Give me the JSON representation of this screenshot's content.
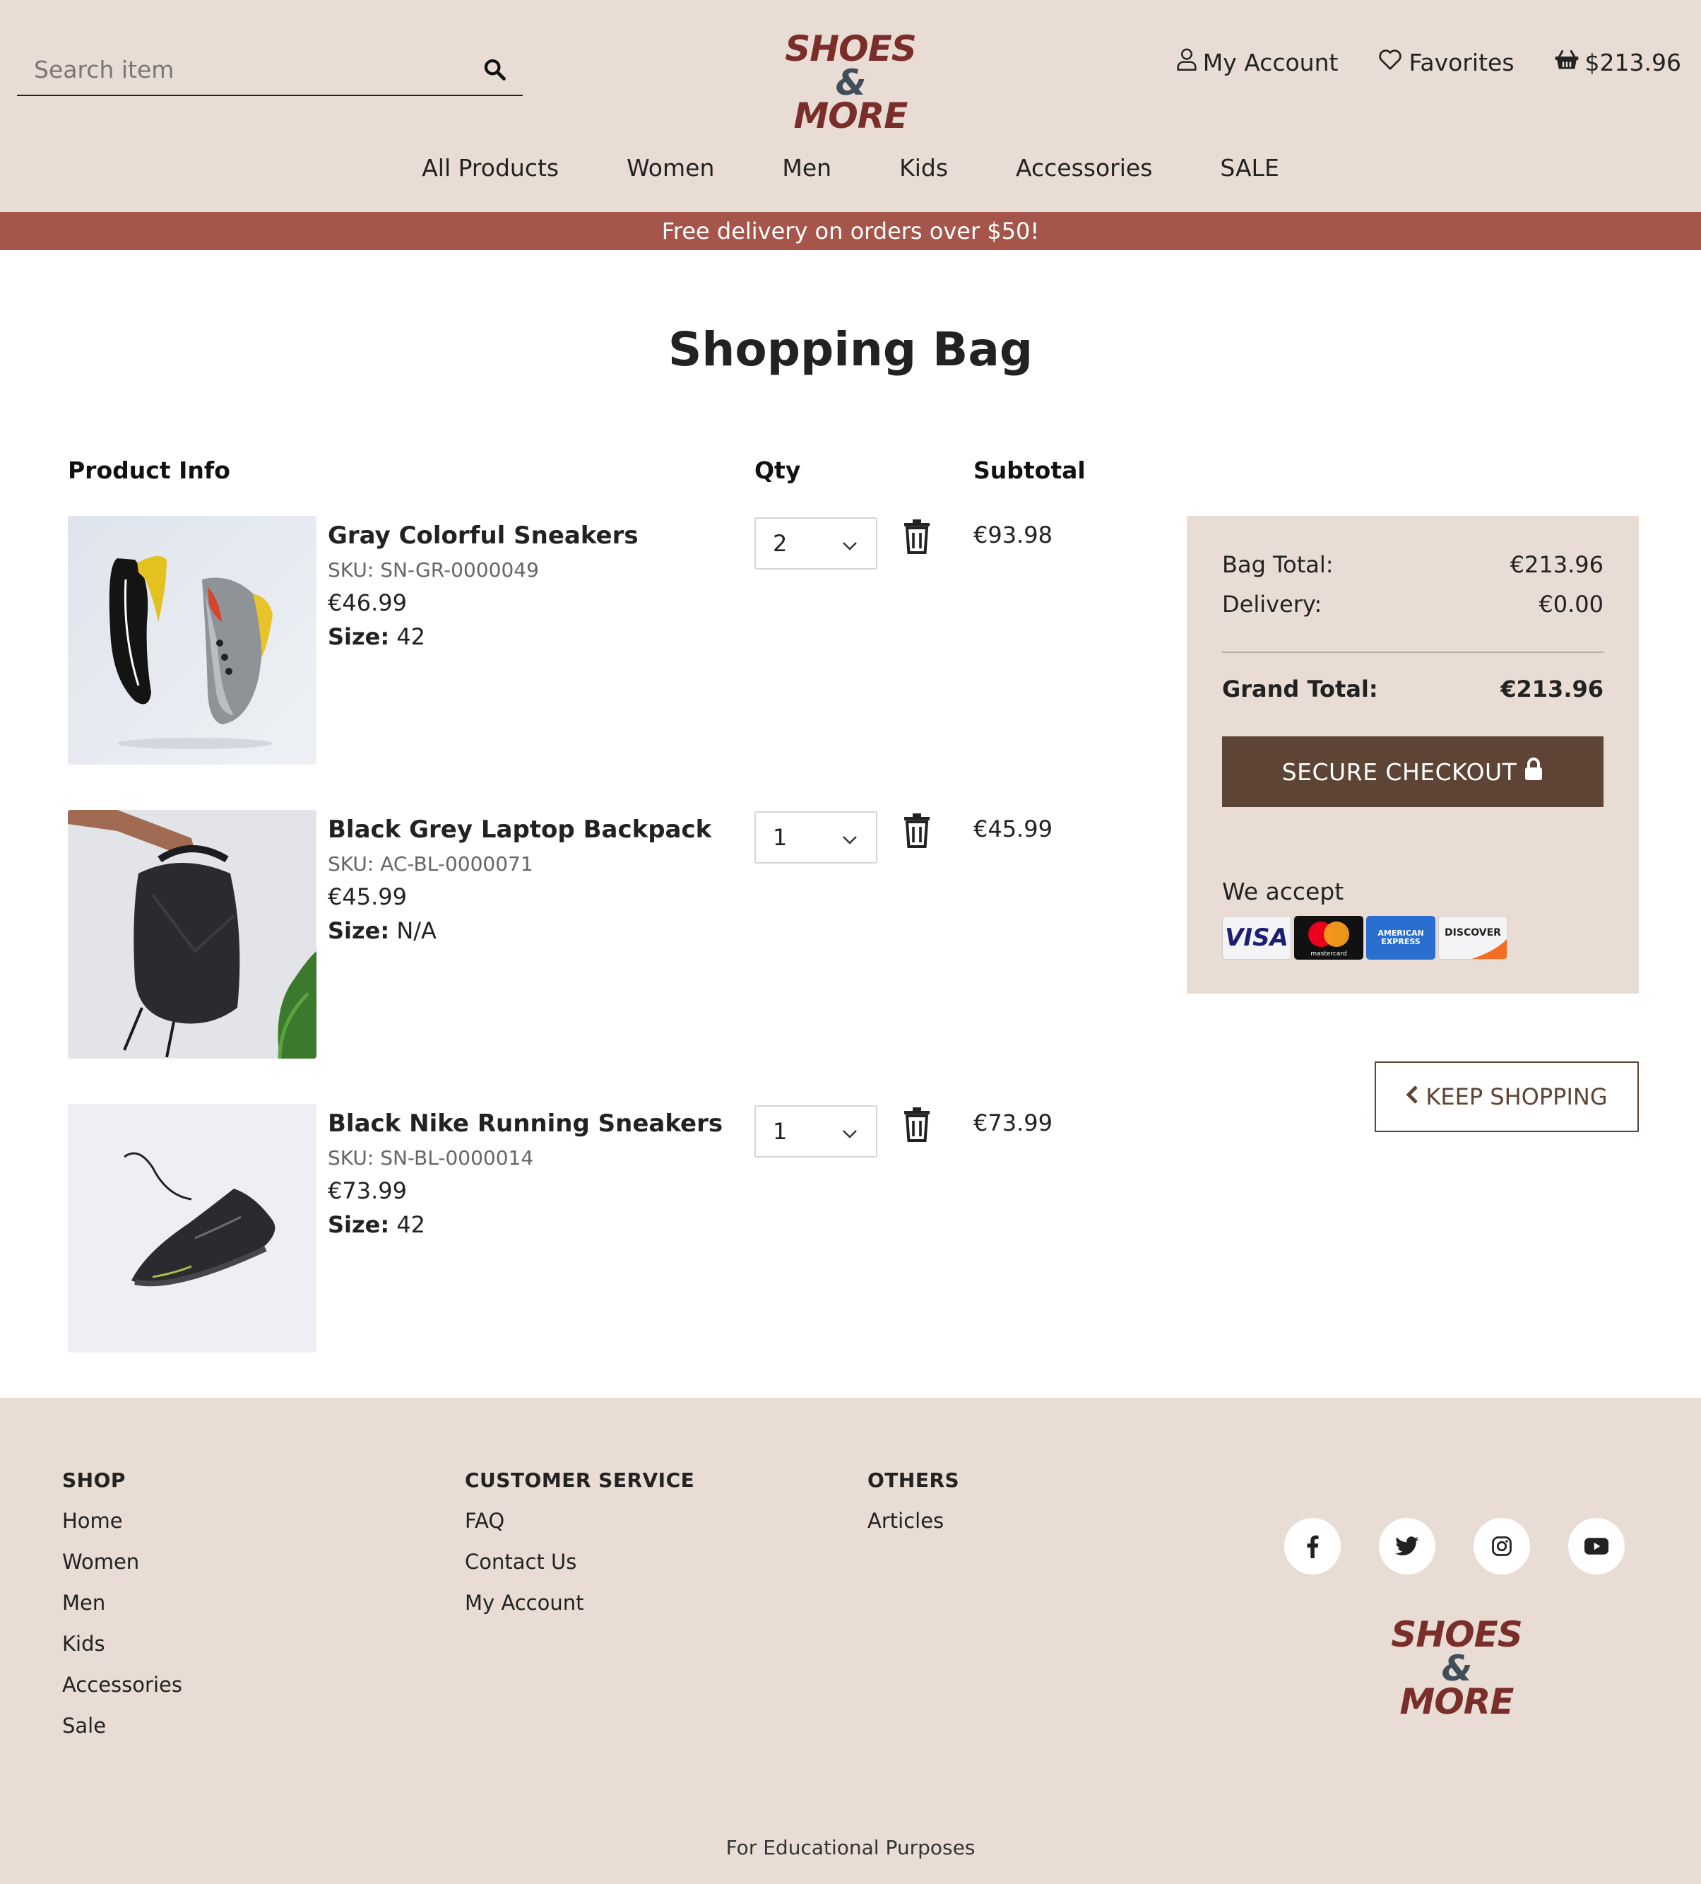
{
  "header": {
    "search_placeholder": "Search item",
    "logo_line1": "SHOES",
    "logo_amp": "&",
    "logo_line2": "MORE",
    "account_label": "My Account",
    "favorites_label": "Favorites",
    "cart_total": "$213.96"
  },
  "nav": [
    "All Products",
    "Women",
    "Men",
    "Kids",
    "Accessories",
    "SALE"
  ],
  "banner": "Free delivery on orders over $50!",
  "page_title": "Shopping Bag",
  "columns": {
    "product": "Product Info",
    "qty": "Qty",
    "subtotal": "Subtotal"
  },
  "items": [
    {
      "name": "Gray Colorful Sneakers",
      "sku": "SKU: SN-GR-0000049",
      "price": "€46.99",
      "size_label": "Size:",
      "size": "42",
      "qty": "2",
      "subtotal": "€93.98",
      "image": "gray-sneakers-image"
    },
    {
      "name": "Black Grey Laptop Backpack",
      "sku": "SKU: AC-BL-0000071",
      "price": "€45.99",
      "size_label": "Size:",
      "size": "N/A",
      "qty": "1",
      "subtotal": "€45.99",
      "image": "backpack-image"
    },
    {
      "name": "Black Nike Running Sneakers",
      "sku": "SKU: SN-BL-0000014",
      "price": "€73.99",
      "size_label": "Size:",
      "size": "42",
      "qty": "1",
      "subtotal": "€73.99",
      "image": "black-sneaker-image"
    }
  ],
  "summary": {
    "bag_total_label": "Bag Total:",
    "bag_total": "€213.96",
    "delivery_label": "Delivery:",
    "delivery": "€0.00",
    "grand_total_label": "Grand Total:",
    "grand_total": "€213.96",
    "checkout_label": "SECURE CHECKOUT",
    "we_accept": "We accept",
    "cards": [
      "VISA",
      "mastercard",
      "AMERICAN EXPRESS",
      "DISCOVER"
    ]
  },
  "keep_shopping": "KEEP SHOPPING",
  "footer": {
    "shop_heading": "SHOP",
    "shop_links": [
      "Home",
      "Women",
      "Men",
      "Kids",
      "Accessories",
      "Sale"
    ],
    "service_heading": "CUSTOMER SERVICE",
    "service_links": [
      "FAQ",
      "Contact Us",
      "My Account"
    ],
    "others_heading": "OTHERS",
    "others_links": [
      "Articles"
    ],
    "socials": [
      "facebook-icon",
      "twitter-icon",
      "instagram-icon",
      "youtube-icon"
    ],
    "copyright": "For Educational Purposes"
  },
  "colors": {
    "header_bg": "#e8dcd5",
    "banner_bg": "#a6554b",
    "button_brown": "#5e4434",
    "logo_red": "#7a2e2a",
    "logo_slate": "#3f4e58"
  }
}
